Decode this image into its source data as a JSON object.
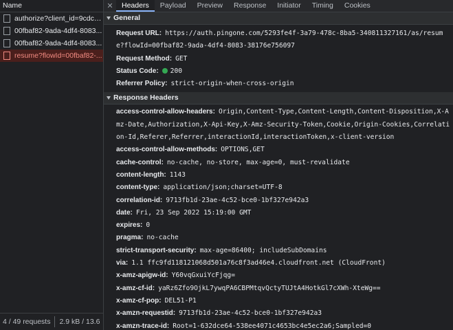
{
  "left_pane": {
    "header": "Name",
    "requests": [
      {
        "name": "authorize?client_id=9cdcd...",
        "selected": false
      },
      {
        "name": "00fbaf82-9ada-4df4-8083...",
        "selected": false
      },
      {
        "name": "00fbaf82-9ada-4df4-8083...",
        "selected": false
      },
      {
        "name": "resume?flowId=00fbaf82-...",
        "selected": true
      }
    ],
    "status": {
      "requests": "4 / 49 requests",
      "transferred": "2.9 kB / 13.6"
    }
  },
  "tabs": [
    "Headers",
    "Payload",
    "Preview",
    "Response",
    "Initiator",
    "Timing",
    "Cookies"
  ],
  "active_tab": "Headers",
  "general": {
    "title": "General",
    "request_url_label": "Request URL:",
    "request_url": "https://auth.pingone.com/5293fe4f-3a79-478c-8ba5-340811327161/as/resume?flowId=00fbaf82-9ada-4df4-8083-38176e756097",
    "request_method_label": "Request Method:",
    "request_method": "GET",
    "status_code_label": "Status Code:",
    "status_code": "200",
    "referrer_policy_label": "Referrer Policy:",
    "referrer_policy": "strict-origin-when-cross-origin"
  },
  "response_headers": {
    "title": "Response Headers",
    "items": [
      {
        "key": "access-control-allow-headers:",
        "value": "Origin,Content-Type,Content-Length,Content-Disposition,X-Amz-Date,Authorization,X-Api-Key,X-Amz-Security-Token,Cookie,Origin-Cookies,Correlation-Id,Referer,Referrer,interactionId,interactionToken,x-client-version"
      },
      {
        "key": "access-control-allow-methods:",
        "value": "OPTIONS,GET"
      },
      {
        "key": "cache-control:",
        "value": "no-cache, no-store, max-age=0, must-revalidate"
      },
      {
        "key": "content-length:",
        "value": "1143"
      },
      {
        "key": "content-type:",
        "value": "application/json;charset=UTF-8"
      },
      {
        "key": "correlation-id:",
        "value": "9713fb1d-23ae-4c52-bce0-1bf327e942a3"
      },
      {
        "key": "date:",
        "value": "Fri, 23 Sep 2022 15:19:00 GMT"
      },
      {
        "key": "expires:",
        "value": "0"
      },
      {
        "key": "pragma:",
        "value": "no-cache"
      },
      {
        "key": "strict-transport-security:",
        "value": "max-age=86400; includeSubDomains"
      },
      {
        "key": "via:",
        "value": "1.1 ffc9fd118121068d501a76c8f3ad46e4.cloudfront.net (CloudFront)"
      },
      {
        "key": "x-amz-apigw-id:",
        "value": "Y60vqGxuiYcFjqg="
      },
      {
        "key": "x-amz-cf-id:",
        "value": "yaRz6Zfo9OjkL7ywqPA6CBPMtqvQctyTUJtA4HotkGl7cXWh-XteWg=="
      },
      {
        "key": "x-amz-cf-pop:",
        "value": "DEL51-P1"
      },
      {
        "key": "x-amzn-requestid:",
        "value": "9713fb1d-23ae-4c52-bce0-1bf327e942a3"
      },
      {
        "key": "x-amzn-trace-id:",
        "value": "Root=1-632dce64-538ee4071c4653bc4e5ec2a6;Sampled=0"
      }
    ]
  },
  "colors": {
    "status_ok": "#34a853",
    "selected_row_text": "#f28b82",
    "active_tab_underline": "#8ab4f8"
  },
  "icons": {
    "close": "close-icon",
    "triangle": "triangle-down-icon"
  }
}
